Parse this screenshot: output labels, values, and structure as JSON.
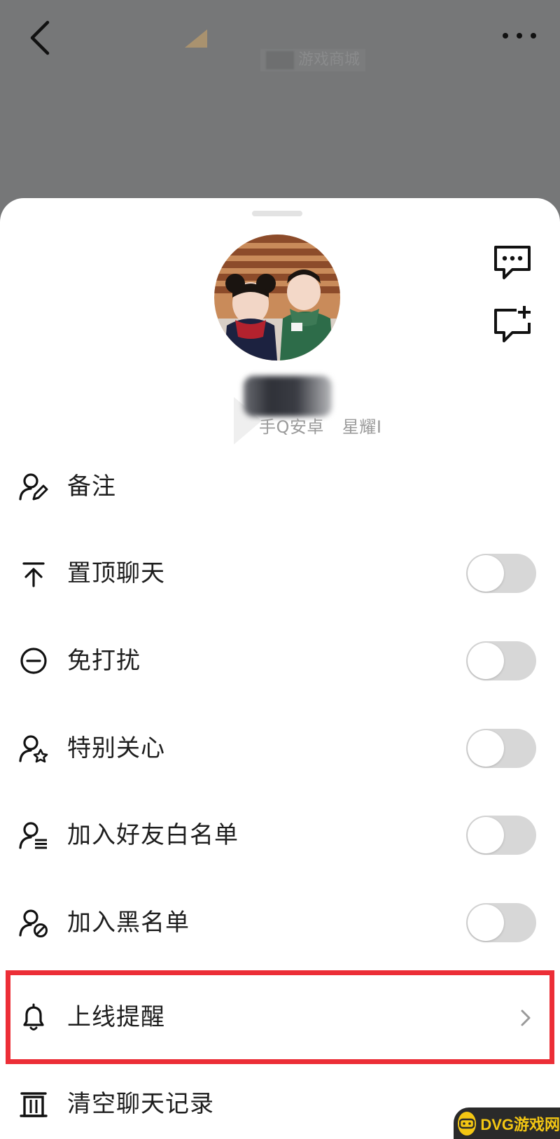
{
  "header": {
    "subtitle": "游戏商城",
    "back_icon": "chevron-left-icon",
    "more_icon": "more-horizontal-icon"
  },
  "profile": {
    "meta": [
      "手Q安卓",
      "星耀I"
    ],
    "side_actions": [
      {
        "icon": "chat-bubble-icon"
      },
      {
        "icon": "chat-add-icon"
      }
    ]
  },
  "settings": [
    {
      "label": "备注",
      "icon": "user-edit-icon",
      "control": "none"
    },
    {
      "label": "置顶聊天",
      "icon": "pin-top-icon",
      "control": "toggle",
      "on": false
    },
    {
      "label": "免打扰",
      "icon": "minus-circle-icon",
      "control": "toggle",
      "on": false
    },
    {
      "label": "特别关心",
      "icon": "user-star-icon",
      "control": "toggle",
      "on": false
    },
    {
      "label": "加入好友白名单",
      "icon": "user-list-icon",
      "control": "toggle",
      "on": false
    },
    {
      "label": "加入黑名单",
      "icon": "user-block-icon",
      "control": "toggle",
      "on": false
    },
    {
      "label": "上线提醒",
      "icon": "bell-icon",
      "control": "chevron"
    },
    {
      "label": "清空聊天记录",
      "icon": "trash-icon",
      "control": "none"
    }
  ],
  "colors": {
    "highlight_border": "#ec2e37",
    "toggle_off": "#d7d7d7",
    "overlay": "#767778"
  },
  "watermark": {
    "text": "DVG游戏网",
    "icon": "gamepad-icon"
  }
}
